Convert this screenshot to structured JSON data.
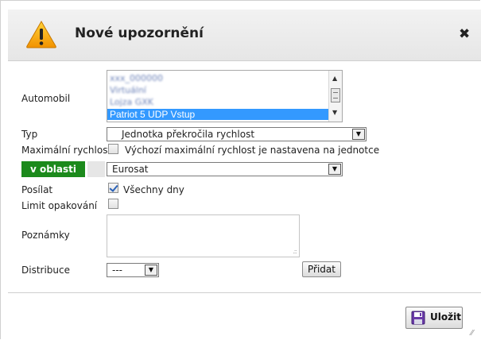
{
  "dialog": {
    "title": "Nové upozornění",
    "close_symbol": "✖",
    "warning_icon": "warning-triangle-icon"
  },
  "form": {
    "vehicle": {
      "label": "Automobil",
      "options_blurred": [
        "xxx_000000",
        "Virtuální",
        "Lojza GXK"
      ],
      "selected": "Patriot 5 UDP Vstup"
    },
    "type": {
      "label": "Typ",
      "value": "Jednotka překročila rychlost"
    },
    "max_speed": {
      "label": "Maximální rychlost",
      "checked": false,
      "text": "Výchozí maximální rychlost je nastavena na jednotce"
    },
    "area": {
      "tag": "v oblasti",
      "value": "Eurosat"
    },
    "send": {
      "label": "Posílat",
      "checked": true,
      "text": "Všechny dny"
    },
    "repeat_limit": {
      "label": "Limit opakování",
      "checked": false
    },
    "notes": {
      "label": "Poznámky",
      "value": ""
    },
    "distribution": {
      "label": "Distribuce",
      "value": "---",
      "add_label": "Přidat"
    }
  },
  "footer": {
    "save_label": "Uložit"
  },
  "colors": {
    "area_tag": "#1c8a1c",
    "selection": "#3399ff",
    "warning": "#f6a400"
  }
}
